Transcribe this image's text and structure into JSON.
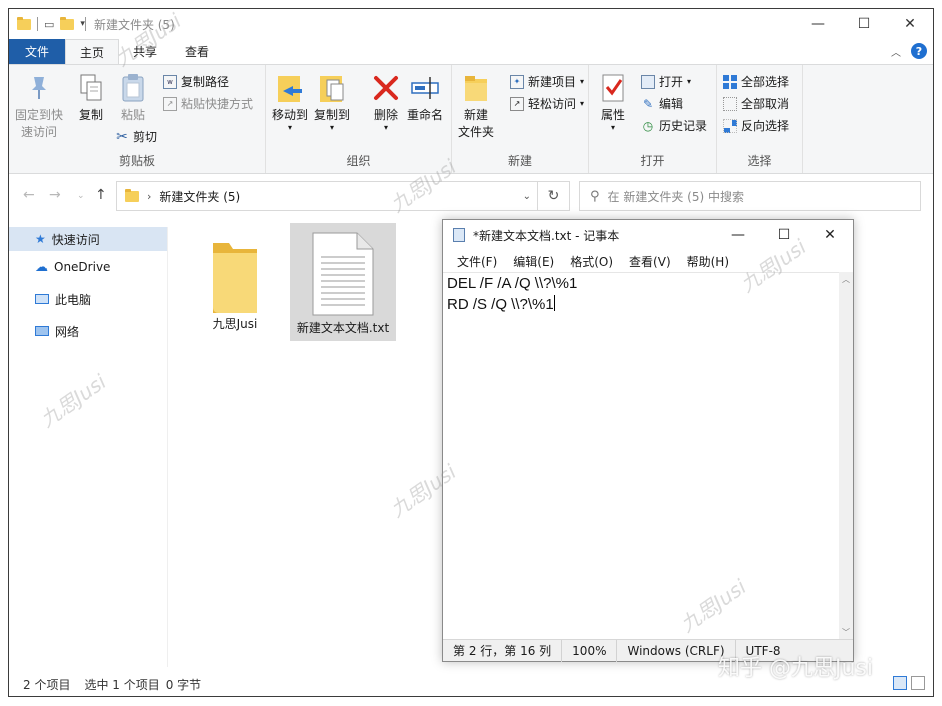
{
  "explorer": {
    "title": "新建文件夹 (5)",
    "tabs": [
      "文件",
      "主页",
      "共享",
      "查看"
    ],
    "ribbon": {
      "clipboard": {
        "pin": "固定到快\n速访问",
        "copy": "复制",
        "paste": "粘贴",
        "copy_path": "复制路径",
        "paste_shortcut": "粘贴快捷方式",
        "cut": "剪切",
        "label": "剪贴板"
      },
      "organize": {
        "move_to": "移动到",
        "copy_to": "复制到",
        "delete": "删除",
        "rename": "重命名",
        "label": "组织"
      },
      "new": {
        "new_folder": "新建\n文件夹",
        "new_item": "新建项目",
        "easy_access": "轻松访问",
        "label": "新建"
      },
      "open": {
        "properties": "属性",
        "open": "打开",
        "edit": "编辑",
        "history": "历史记录",
        "label": "打开"
      },
      "select": {
        "select_all": "全部选择",
        "select_none": "全部取消",
        "invert": "反向选择",
        "label": "选择"
      }
    },
    "address": "新建文件夹 (5)",
    "search_placeholder": "在 新建文件夹 (5) 中搜索",
    "nav": [
      "快速访问",
      "OneDrive",
      "此电脑",
      "网络"
    ],
    "files": [
      {
        "name": "九思Jusi",
        "type": "folder"
      },
      {
        "name": "新建文本文档.txt",
        "type": "text"
      }
    ],
    "status": {
      "count": "2 个项目",
      "selected": "选中 1 个项目",
      "size": "0 字节"
    }
  },
  "notepad": {
    "title": "*新建文本文档.txt - 记事本",
    "menu": [
      "文件(F)",
      "编辑(E)",
      "格式(O)",
      "查看(V)",
      "帮助(H)"
    ],
    "lines": [
      "DEL /F /A /Q \\\\?\\%1",
      "RD /S /Q \\\\?\\%1"
    ],
    "status": {
      "position": "第 2 行，第 16 列",
      "zoom": "100%",
      "line_ending": "Windows (CRLF)",
      "encoding": "UTF-8"
    }
  },
  "watermark": "九思Jusi",
  "zhihu_mark": "知乎 @九思Jusi",
  "colors": {
    "file_tab": "#1f5ea8",
    "selection": "#d9e5f3",
    "folder": "#f6cf5a",
    "delete_red": "#d9281e"
  }
}
